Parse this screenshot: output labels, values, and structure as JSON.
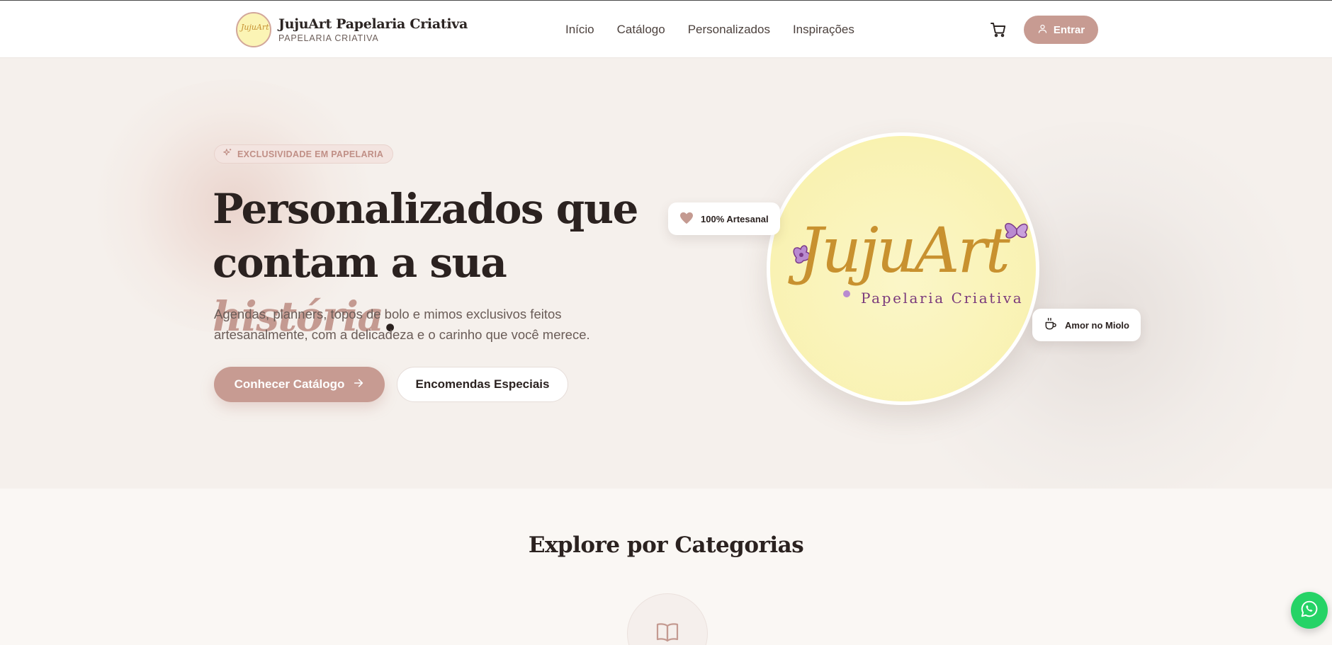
{
  "header": {
    "brand_title": "JujuArt Papelaria Criativa",
    "brand_subtitle": "PAPELARIA CRIATIVA",
    "brand_logo_text": "JujuArt",
    "nav": [
      {
        "label": "Início"
      },
      {
        "label": "Catálogo"
      },
      {
        "label": "Personalizados"
      },
      {
        "label": "Inspirações"
      }
    ],
    "cart_icon": "cart-icon",
    "login_label": "Entrar",
    "login_icon": "user-icon"
  },
  "hero": {
    "tag_label": "EXCLUSIVIDADE EM PAPELARIA",
    "tag_icon": "sparkles-icon",
    "headline_part1": "Personalizados que contam a sua ",
    "headline_accent": "história",
    "headline_end": ".",
    "lead": "Agendas, planners, topos de bolo e mimos exclusivos feitos artesanalmente, com a delicadeza e o carinho que você merece.",
    "primary_button": "Conhecer Catálogo",
    "primary_button_icon": "arrow-right-icon",
    "secondary_button": "Encomendas Especiais",
    "logo_script": "JujuArt",
    "logo_tagline": "Papelaria Criativa",
    "badge_1": "100% Artesanal",
    "badge_1_icon": "heart-icon",
    "badge_2": "Amor no Miolo",
    "badge_2_icon": "coffee-cup-icon"
  },
  "categories": {
    "title": "Explore por Categorias",
    "first_icon": "book-open-icon"
  },
  "whatsapp_icon": "whatsapp-icon",
  "colors": {
    "accent": "#c79b92",
    "hero_bg": "#f5f0ec",
    "logo_bg": "#f9f2b2",
    "logo_gold": "#c8912f",
    "logo_purple": "#8a3f8c",
    "whatsapp": "#25d366"
  }
}
